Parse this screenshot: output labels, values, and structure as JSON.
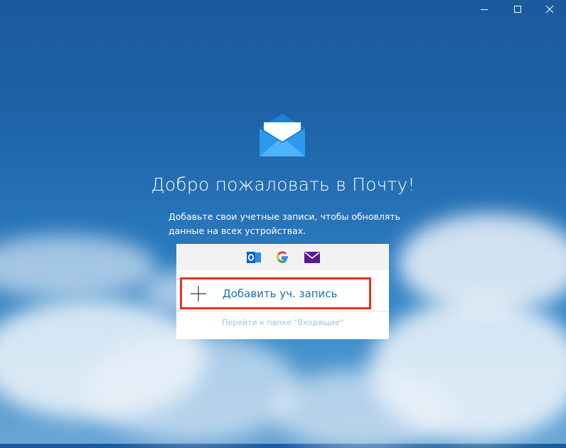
{
  "window": {
    "controls": {
      "minimize": "minimize-icon",
      "maximize": "maximize-icon",
      "close": "close-icon"
    }
  },
  "welcome": {
    "logo": "mail-envelope-icon",
    "title": "Добро пожаловать в Почту!",
    "subtitle": "Добавьте свои учетные записи, чтобы обновлять данные на всех устройствах."
  },
  "card": {
    "providers": [
      {
        "icon": "outlook-icon"
      },
      {
        "icon": "google-icon"
      },
      {
        "icon": "yahoo-mail-icon"
      }
    ],
    "add_account_label": "Добавить уч. запись",
    "go_to_inbox_label": "Перейти к папке \"Входящие\""
  },
  "colors": {
    "accent": "#1a6ebd",
    "highlight_border": "#e8321f",
    "link_muted": "#9cc3e6",
    "outlook": "#0a64c8",
    "yahoo": "#5b1a8e"
  }
}
